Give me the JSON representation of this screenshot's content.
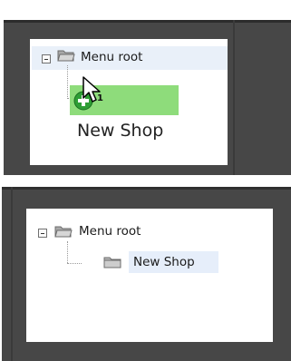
{
  "tree": {
    "root_label": "Menu root",
    "child_label": "New Shop"
  },
  "drag": {
    "count": "1",
    "item_label": "New Shop"
  },
  "colors": {
    "background_panel": "#474747",
    "drop_indicator": "#8edc7b",
    "selection": "#e6eefa"
  },
  "icons": [
    "collapse-toggle-icon",
    "folder-open-icon",
    "folder-icon",
    "add-circle-icon",
    "mouse-cursor-icon"
  ]
}
